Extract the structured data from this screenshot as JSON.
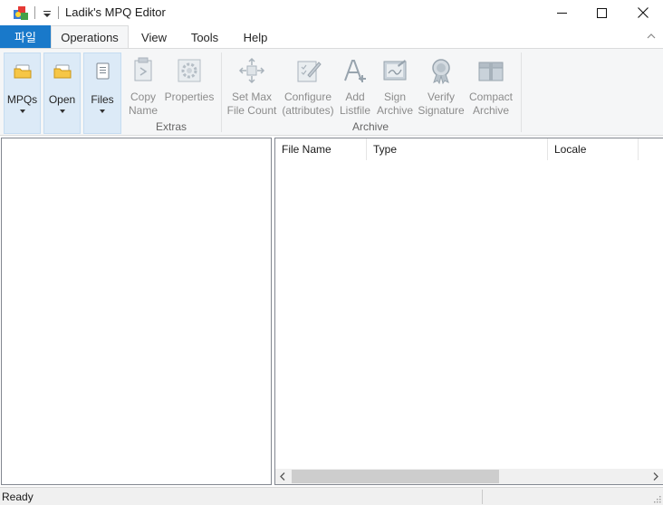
{
  "window": {
    "title": "Ladik's MPQ Editor",
    "icons": {
      "app": "mpq-editor-app-icon",
      "qat": "customize-quick-access-arrow-icon",
      "minimize": "minimize-icon",
      "maximize": "maximize-icon",
      "close": "close-icon"
    }
  },
  "tabs": {
    "file": "파일",
    "items": [
      {
        "label": "Operations",
        "active": true
      },
      {
        "label": "View",
        "active": false
      },
      {
        "label": "Tools",
        "active": false
      },
      {
        "label": "Help",
        "active": false
      }
    ]
  },
  "ribbon": {
    "mpqs": {
      "label": "MPQs",
      "icon": "folder-yellow-icon"
    },
    "open": {
      "label": "Open",
      "icon": "folder-open-icon"
    },
    "files": {
      "label": "Files",
      "icon": "document-icon"
    },
    "extras": {
      "group_label": "Extras",
      "copy_name_1": "Copy",
      "copy_name_2": "Name",
      "properties": "Properties"
    },
    "archive": {
      "group_label": "Archive",
      "set_max_1": "Set Max",
      "set_max_2": "File Count",
      "configure_1": "Configure",
      "configure_2": "(attributes)",
      "add_listfile_1": "Add",
      "add_listfile_2": "Listfile",
      "sign_1": "Sign",
      "sign_2": "Archive",
      "verify_1": "Verify",
      "verify_2": "Signature",
      "compact_1": "Compact",
      "compact_2": "Archive"
    }
  },
  "file_list": {
    "columns": [
      "File Name",
      "Type",
      "Locale"
    ]
  },
  "status": {
    "text": "Ready"
  },
  "colors": {
    "accent": "#1979ca",
    "ribbon_bg": "#f5f6f7",
    "selected_btn": "#dceaf7"
  }
}
